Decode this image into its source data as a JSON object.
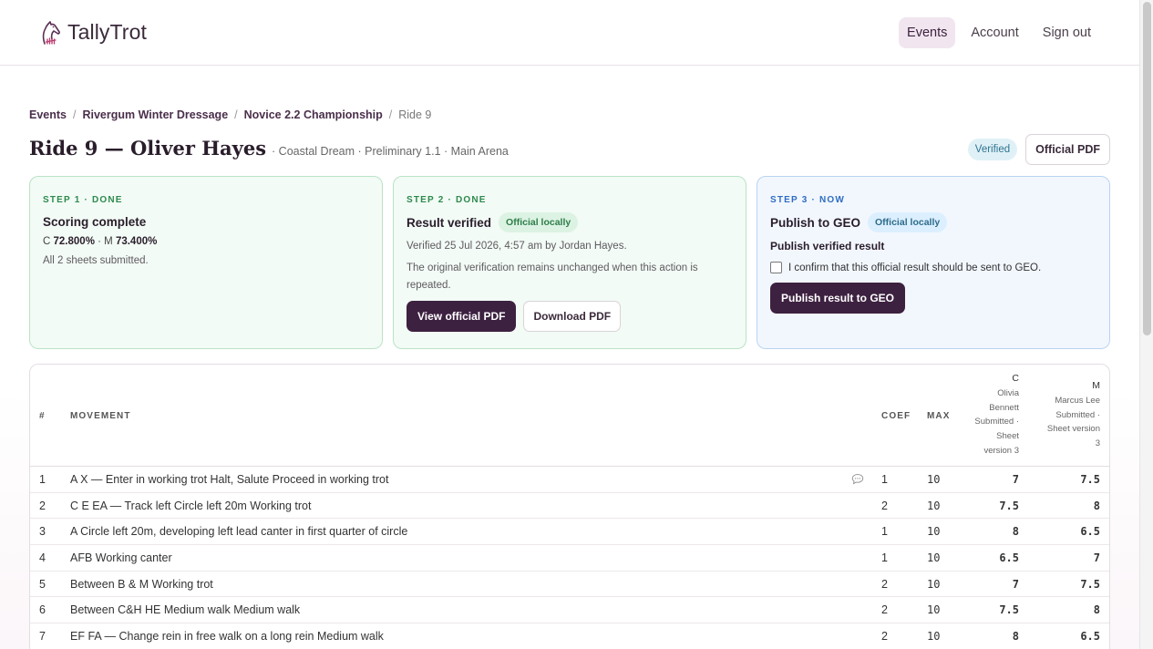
{
  "app": {
    "name": "TallyTrot"
  },
  "nav": {
    "events": "Events",
    "account": "Account",
    "sign_out": "Sign out"
  },
  "breadcrumb": {
    "events": "Events",
    "competition": "Rivergum Winter Dressage",
    "class": "Novice 2.2 Championship",
    "ride": "Ride 9",
    "sep": "/"
  },
  "ride": {
    "title": "Ride 9 — Oliver Hayes",
    "subtitle": "· Coastal Dream · Preliminary 1.1 · Main Arena",
    "status": "Verified",
    "official_pdf": "Official PDF"
  },
  "steps": {
    "one": {
      "label": "STEP 1 · DONE",
      "title": "Scoring complete",
      "c_prefix": "C",
      "c_score": "72.800%",
      "m_prefix": "· M",
      "m_score": "73.400%",
      "note": "All 2 sheets submitted."
    },
    "two": {
      "label": "STEP 2 · DONE",
      "title": "Result verified",
      "pill": "Official locally",
      "verified_line": "Verified 25 Jul 2026, 4:57 am by Jordan Hayes.",
      "note": "The original verification remains unchanged when this action is repeated.",
      "view_pdf": "View official PDF",
      "download_pdf": "Download PDF"
    },
    "three": {
      "label": "STEP 3 · NOW",
      "title": "Publish to GEO",
      "pill": "Official locally",
      "subtitle": "Publish verified result",
      "confirm": "I confirm that this official result should be sent to GEO.",
      "publish": "Publish result to GEO"
    }
  },
  "table": {
    "headers": {
      "num": "#",
      "movement": "MOVEMENT",
      "coef": "COEF",
      "max": "MAX"
    },
    "judges": [
      {
        "letter": "C",
        "name_1": "Olivia",
        "name_2": "Bennett",
        "status": "Submitted ·",
        "sheet_1": "Sheet",
        "sheet_2": "version 3"
      },
      {
        "letter": "M",
        "name": "Marcus Lee",
        "status": "Submitted ·",
        "sheet": "Sheet version",
        "version": "3"
      }
    ],
    "rows": [
      {
        "num": "1",
        "movement": "A X — Enter in working trot Halt, Salute Proceed in working trot",
        "coef": "1",
        "max": "10",
        "c": "7",
        "m": "7.5",
        "comment": true
      },
      {
        "num": "2",
        "movement": "C E EA — Track left Circle left 20m Working trot",
        "coef": "2",
        "max": "10",
        "c": "7.5",
        "m": "8"
      },
      {
        "num": "3",
        "movement": "A Circle left 20m, developing left lead canter in first quarter of circle",
        "coef": "1",
        "max": "10",
        "c": "8",
        "m": "6.5"
      },
      {
        "num": "4",
        "movement": "AFB Working canter",
        "coef": "1",
        "max": "10",
        "c": "6.5",
        "m": "7"
      },
      {
        "num": "5",
        "movement": "Between B & M Working trot",
        "coef": "2",
        "max": "10",
        "c": "7",
        "m": "7.5"
      },
      {
        "num": "6",
        "movement": "Between C&H HE Medium walk Medium walk",
        "coef": "2",
        "max": "10",
        "c": "7.5",
        "m": "8"
      },
      {
        "num": "7",
        "movement": "EF FA — Change rein in free walk on a long rein Medium walk",
        "coef": "2",
        "max": "10",
        "c": "8",
        "m": "6.5"
      }
    ]
  }
}
